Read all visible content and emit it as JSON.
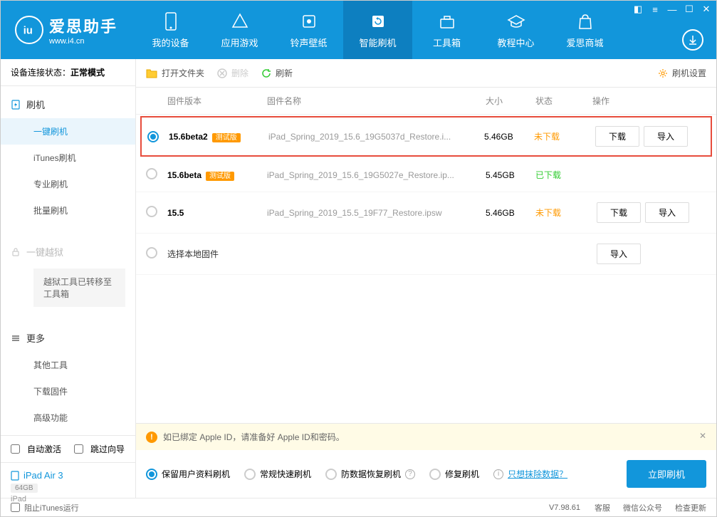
{
  "logo": {
    "main": "爱思助手",
    "sub": "www.i4.cn",
    "letters": "iu"
  },
  "nav": [
    {
      "label": "我的设备"
    },
    {
      "label": "应用游戏"
    },
    {
      "label": "铃声壁纸"
    },
    {
      "label": "智能刷机"
    },
    {
      "label": "工具箱"
    },
    {
      "label": "教程中心"
    },
    {
      "label": "爱思商城"
    }
  ],
  "sidebar": {
    "conn_label": "设备连接状态：",
    "conn_value": "正常模式",
    "flash_head": "刷机",
    "items": [
      "一键刷机",
      "iTunes刷机",
      "专业刷机",
      "批量刷机"
    ],
    "jailbreak_head": "一键越狱",
    "jailbreak_note": "越狱工具已转移至工具箱",
    "more_head": "更多",
    "more_items": [
      "其他工具",
      "下载固件",
      "高级功能"
    ],
    "auto_activate": "自动激活",
    "skip_guide": "跳过向导",
    "device_name": "iPad Air 3",
    "device_storage": "64GB",
    "device_type": "iPad"
  },
  "toolbar": {
    "open_folder": "打开文件夹",
    "delete": "删除",
    "refresh": "刷新",
    "settings": "刷机设置"
  },
  "columns": {
    "version": "固件版本",
    "name": "固件名称",
    "size": "大小",
    "status": "状态",
    "ops": "操作"
  },
  "firmware": [
    {
      "version": "15.6beta2",
      "beta": "测试版",
      "name": "iPad_Spring_2019_15.6_19G5037d_Restore.i...",
      "size": "5.46GB",
      "status": "未下载",
      "status_cls": "undl",
      "ops": [
        "下载",
        "导入"
      ],
      "checked": true,
      "highlighted": true
    },
    {
      "version": "15.6beta",
      "beta": "测试版",
      "name": "iPad_Spring_2019_15.6_19G5027e_Restore.ip...",
      "size": "5.45GB",
      "status": "已下载",
      "status_cls": "dl",
      "ops": [],
      "checked": false
    },
    {
      "version": "15.5",
      "beta": "",
      "name": "iPad_Spring_2019_15.5_19F77_Restore.ipsw",
      "size": "5.46GB",
      "status": "未下载",
      "status_cls": "undl",
      "ops": [
        "下载",
        "导入"
      ],
      "checked": false
    },
    {
      "version": "",
      "beta": "",
      "name_main": "选择本地固件",
      "size": "",
      "status": "",
      "ops": [
        "导入"
      ],
      "checked": false,
      "local": true
    }
  ],
  "notice": "如已绑定 Apple ID，请准备好 Apple ID和密码。",
  "flash_options": [
    "保留用户资料刷机",
    "常规快速刷机",
    "防数据恢复刷机",
    "修复刷机"
  ],
  "erase_link": "只想抹除数据？",
  "flash_btn": "立即刷机",
  "footer": {
    "block_itunes": "阻止iTunes运行",
    "version": "V7.98.61",
    "links": [
      "客服",
      "微信公众号",
      "检查更新"
    ]
  }
}
